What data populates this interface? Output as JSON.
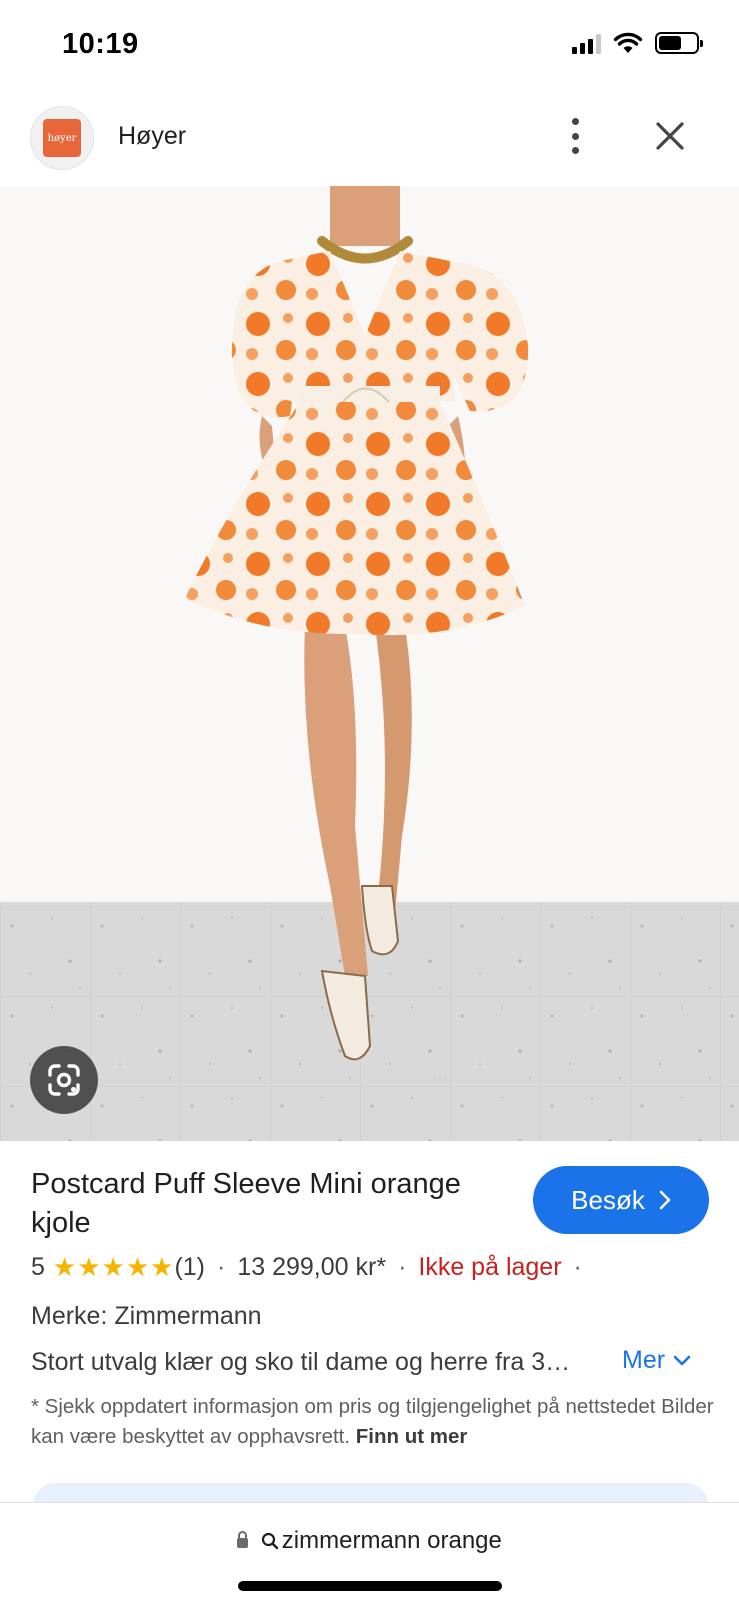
{
  "status_bar": {
    "time": "10:19",
    "battery_level": 0.62
  },
  "header": {
    "logo_text": "høyer",
    "site_name": "Høyer"
  },
  "product": {
    "title": "Postcard Puff Sleeve Mini orange kjole",
    "visit_label": "Besøk",
    "rating": "5",
    "stars": "★★★★★",
    "reviews": "(1)",
    "price": "13 299,00 kr*",
    "stock": "Ikke på lager",
    "brand": "Merke: Zimmermann",
    "description": "Stort utvalg klær og sko til dame og herre fra 3…",
    "more_label": "Mer",
    "disclaimer": "* Sjekk oppdatert informasjon om pris og tilgjengelighet på nettstedet Bilder kan være beskyttet av opphavsrett.",
    "learn_more": "Finn ut mer"
  },
  "address_bar": {
    "query": "zimmermann orange"
  },
  "colors": {
    "accent": "#1a73e8",
    "out_of_stock": "#c5221f",
    "star": "#f4b400",
    "logo": "#e8673a"
  }
}
